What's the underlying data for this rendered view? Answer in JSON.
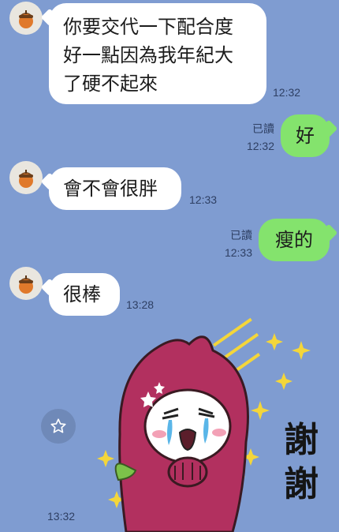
{
  "messages": [
    {
      "side": "in",
      "text": "你要交代一下配合度好一點因為我年紀大了硬不起來",
      "lines": [
        "你要交代一下配合度",
        "好一點因為我年紀大",
        "了硬不起來"
      ],
      "time": "12:32"
    },
    {
      "side": "out",
      "text": "好",
      "read": "已讀",
      "time": "12:32"
    },
    {
      "side": "in",
      "text": "會不會很胖",
      "time": "12:33"
    },
    {
      "side": "out",
      "text": "瘦的",
      "read": "已讀",
      "time": "12:33"
    },
    {
      "side": "in",
      "text": "很棒",
      "time": "13:28"
    },
    {
      "side": "in",
      "type": "sticker",
      "sticker_text": "謝謝",
      "sticker_chars": [
        "謝",
        "謝"
      ],
      "time": "13:32"
    }
  ],
  "colors": {
    "background": "#7f9cd1",
    "incoming_bubble": "#ffffff",
    "outgoing_bubble": "#84e36d",
    "sticker_body": "#b2305f",
    "sparkle": "#f4d63a"
  },
  "icons": {
    "avatar": "acorn-icon",
    "sticker_share": "star-outline-icon"
  }
}
